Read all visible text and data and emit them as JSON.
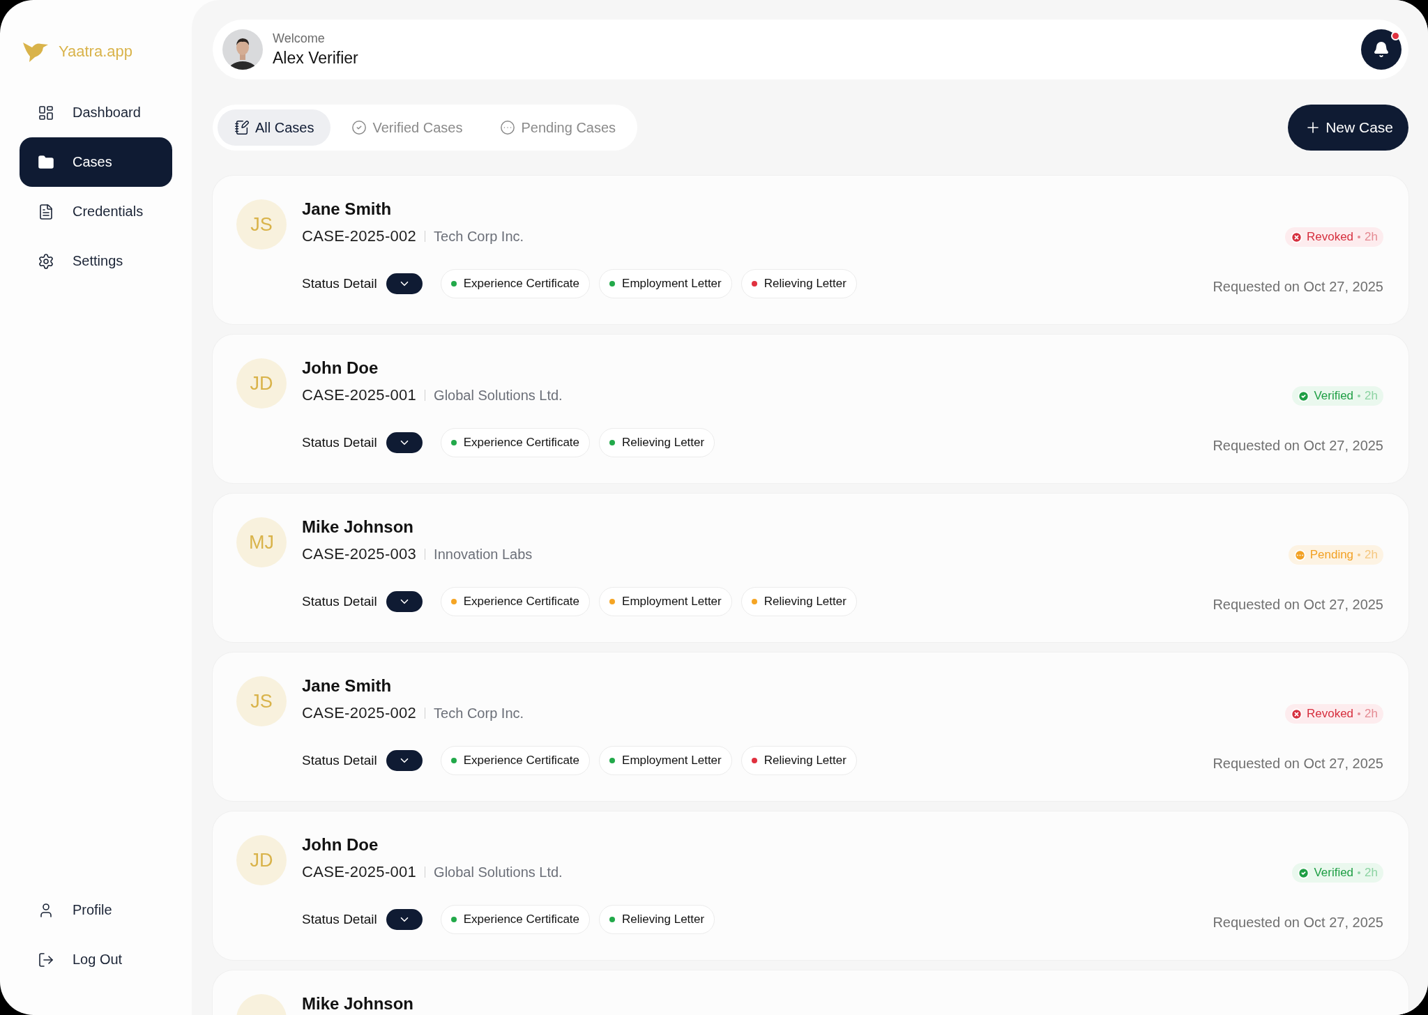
{
  "brand": {
    "name": "Yaatra.app"
  },
  "sidebar": {
    "items": [
      {
        "label": "Dashboard",
        "kind": "dashboard",
        "selected": false
      },
      {
        "label": "Cases",
        "kind": "cases",
        "selected": true
      },
      {
        "label": "Credentials",
        "kind": "credentials",
        "selected": false
      },
      {
        "label": "Settings",
        "kind": "settings",
        "selected": false
      }
    ],
    "bottom_items": [
      {
        "label": "Profile",
        "kind": "profile"
      },
      {
        "label": "Log Out",
        "kind": "logout"
      }
    ]
  },
  "header": {
    "greeting": "Welcome",
    "user_name": "Alex Verifier",
    "has_notification": true
  },
  "tabs": [
    {
      "label": "All Cases",
      "kind": "all",
      "selected": true
    },
    {
      "label": "Verified Cases",
      "kind": "verified",
      "selected": false
    },
    {
      "label": "Pending Cases",
      "kind": "pending",
      "selected": false
    }
  ],
  "new_case_button": "New Case",
  "cases": [
    {
      "initials": "JS",
      "name": "Jane Smith",
      "case_id": "CASE-2025-002",
      "company": "Tech Corp Inc.",
      "status": {
        "kind": "revoked",
        "label": "Revoked",
        "age": "2h"
      },
      "detail_label": "Status Detail",
      "documents": [
        {
          "label": "Experience Certificate",
          "color": "#22a94a"
        },
        {
          "label": "Employment Letter",
          "color": "#22a94a"
        },
        {
          "label": "Relieving Letter",
          "color": "#e0313f"
        }
      ],
      "requested": "Requested on Oct 27, 2025"
    },
    {
      "initials": "JD",
      "name": "John Doe",
      "case_id": "CASE-2025-001",
      "company": "Global Solutions Ltd.",
      "status": {
        "kind": "verified",
        "label": "Verified",
        "age": "2h"
      },
      "detail_label": "Status Detail",
      "documents": [
        {
          "label": "Experience Certificate",
          "color": "#22a94a"
        },
        {
          "label": "Relieving Letter",
          "color": "#22a94a"
        }
      ],
      "requested": "Requested on Oct 27, 2025"
    },
    {
      "initials": "MJ",
      "name": "Mike Johnson",
      "case_id": "CASE-2025-003",
      "company": "Innovation Labs",
      "status": {
        "kind": "pending",
        "label": "Pending",
        "age": "2h"
      },
      "detail_label": "Status Detail",
      "documents": [
        {
          "label": "Experience Certificate",
          "color": "#f5a524"
        },
        {
          "label": "Employment Letter",
          "color": "#f5a524"
        },
        {
          "label": "Relieving Letter",
          "color": "#f5a524"
        }
      ],
      "requested": "Requested on Oct 27, 2025"
    },
    {
      "initials": "JS",
      "name": "Jane Smith",
      "case_id": "CASE-2025-002",
      "company": "Tech Corp Inc.",
      "status": {
        "kind": "revoked",
        "label": "Revoked",
        "age": "2h"
      },
      "detail_label": "Status Detail",
      "documents": [
        {
          "label": "Experience Certificate",
          "color": "#22a94a"
        },
        {
          "label": "Employment Letter",
          "color": "#22a94a"
        },
        {
          "label": "Relieving Letter",
          "color": "#e0313f"
        }
      ],
      "requested": "Requested on Oct 27, 2025"
    },
    {
      "initials": "JD",
      "name": "John Doe",
      "case_id": "CASE-2025-001",
      "company": "Global Solutions Ltd.",
      "status": {
        "kind": "verified",
        "label": "Verified",
        "age": "2h"
      },
      "detail_label": "Status Detail",
      "documents": [
        {
          "label": "Experience Certificate",
          "color": "#22a94a"
        },
        {
          "label": "Relieving Letter",
          "color": "#22a94a"
        }
      ],
      "requested": "Requested on Oct 27, 2025"
    }
  ],
  "cut_off_case": {
    "name": "Mike Johnson"
  }
}
